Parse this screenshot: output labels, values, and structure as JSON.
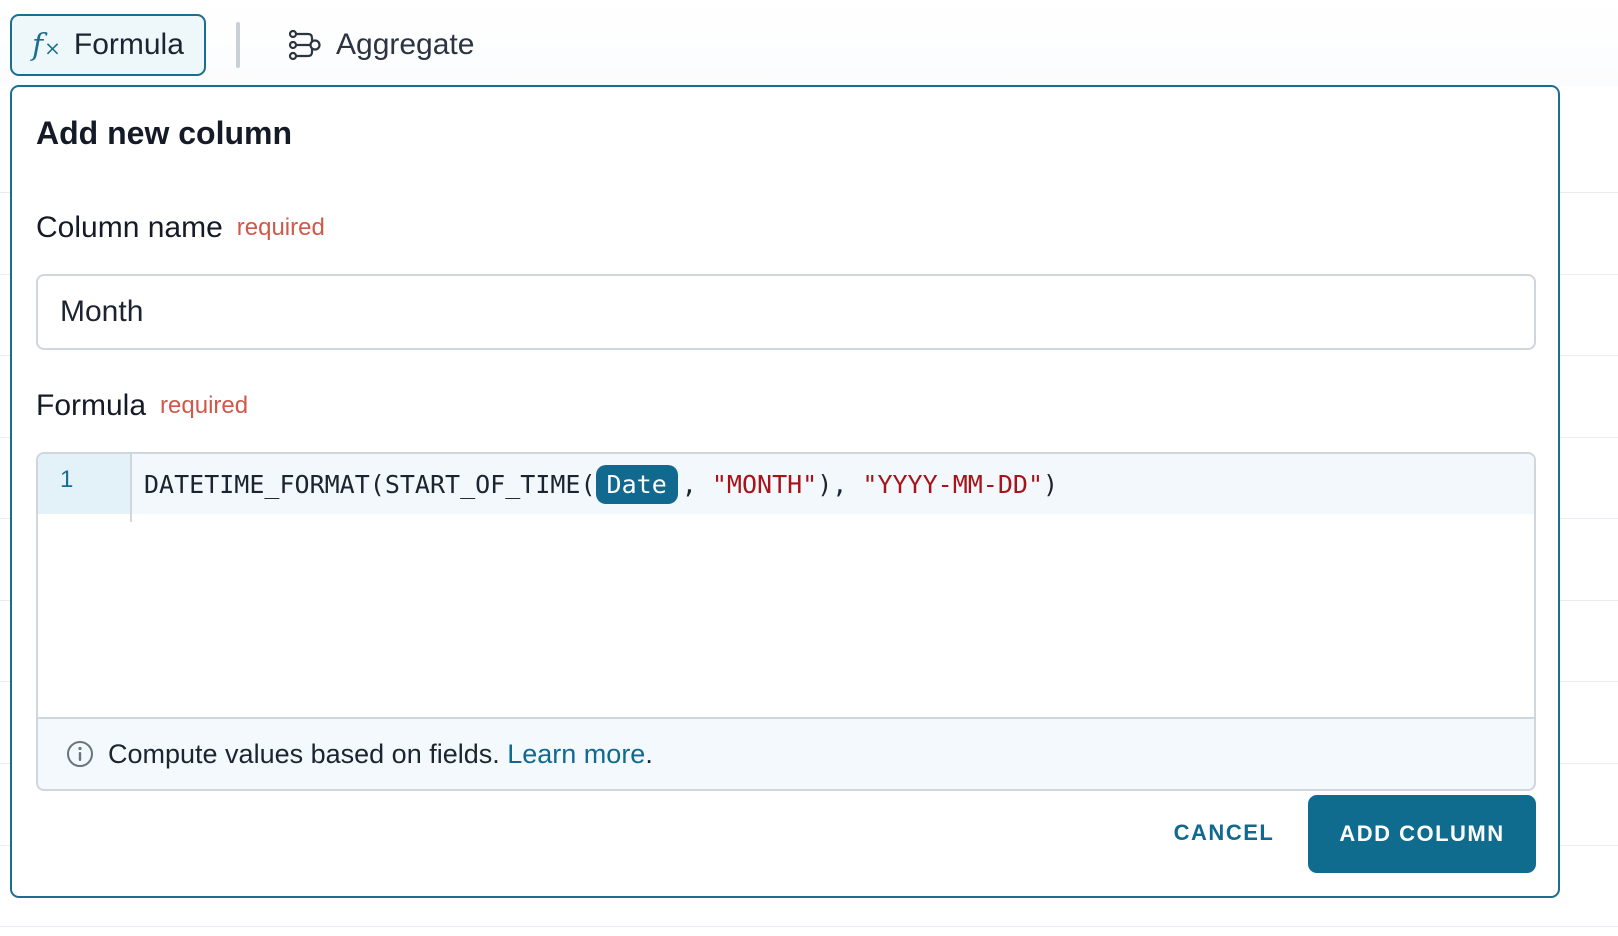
{
  "toolbar": {
    "formula_label": "Formula",
    "formula_icon": "fx-icon",
    "aggregate_label": "Aggregate",
    "aggregate_icon": "aggregate-icon"
  },
  "dialog": {
    "title": "Add new column",
    "column_name": {
      "label": "Column name",
      "required_text": "required",
      "value": "Month"
    },
    "formula": {
      "label": "Formula",
      "required_text": "required",
      "line_number": "1",
      "code": {
        "fn_prefix": "DATETIME_FORMAT(START_OF_TIME(",
        "field_token": "Date",
        "sep1": ", ",
        "arg1": "\"MONTH\"",
        "mid": "), ",
        "arg2": "\"YYYY-MM-DD\"",
        "suffix": ")"
      }
    },
    "help": {
      "icon": "info-icon",
      "text": "Compute values based on fields. ",
      "link_text": "Learn more",
      "trailing": "."
    },
    "buttons": {
      "cancel": "CANCEL",
      "add": "ADD COLUMN"
    }
  },
  "colors": {
    "accent": "#0f6c8f",
    "required": "#d0584a",
    "string_literal": "#a8131a"
  }
}
